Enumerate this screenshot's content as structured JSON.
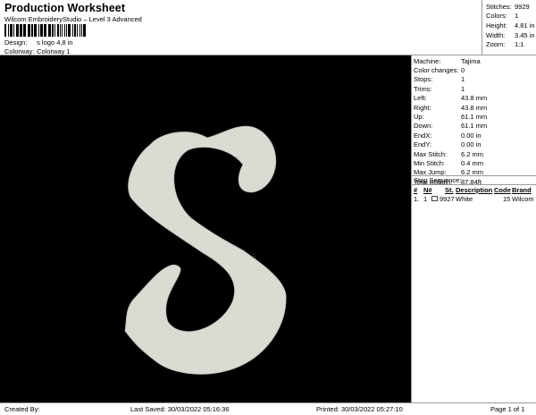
{
  "header": {
    "title": "Production Worksheet",
    "subtitle": "Wilcom EmbroideryStudio – Level 3 Advanced",
    "barcode_text": "s logo 4,8 in",
    "design_label": "Design:",
    "design_value": "s logo 4,8 in",
    "colorway_label": "Colorway:",
    "colorway_value": "Colorway 1"
  },
  "summary": [
    {
      "label": "Stitches:",
      "value": "9929"
    },
    {
      "label": "Colors:",
      "value": "1"
    },
    {
      "label": "Height:",
      "value": "4.81 in"
    },
    {
      "label": "Width:",
      "value": "3.45 in"
    },
    {
      "label": "Zoom:",
      "value": "1:1"
    }
  ],
  "properties": [
    {
      "label": "Machine:",
      "value": "Tajima"
    },
    {
      "label": "Color changes:",
      "value": "0"
    },
    {
      "label": "Stops:",
      "value": "1"
    },
    {
      "label": "Trims:",
      "value": "1"
    },
    {
      "label": "Left:",
      "value": "43.8 mm"
    },
    {
      "label": "Right:",
      "value": "43.8 mm"
    },
    {
      "label": "Up:",
      "value": "61.1 mm"
    },
    {
      "label": "Down:",
      "value": "61.1 mm"
    },
    {
      "label": "EndX:",
      "value": "0.00 in"
    },
    {
      "label": "EndY:",
      "value": "0.00 in"
    },
    {
      "label": "Max Stitch:",
      "value": "6.2 mm"
    },
    {
      "label": "Min Stitch:",
      "value": "0.4 mm"
    },
    {
      "label": "Max Jump:",
      "value": "6.2 mm"
    },
    {
      "label": "Total Bobbin:",
      "value": "87.84ft"
    }
  ],
  "stop_sequence": {
    "title": "Stop Sequence:",
    "columns": [
      "#",
      "N#",
      "St.",
      "Description",
      "Code",
      "Brand"
    ],
    "rows": [
      {
        "num": "1.",
        "n": "1",
        "st": "9927",
        "description": "White",
        "code": "15",
        "brand": "Wilcom",
        "swatch_color": "#ffffff"
      }
    ]
  },
  "design": {
    "background_color": "#000000",
    "thread_color": "#dcdfd6"
  },
  "footer": {
    "created_by": "Created By:",
    "last_saved": "Last Saved: 30/03/2022 05:16:36",
    "printed": "Printed: 30/03/2022 05:27:10",
    "page": "Page 1 of 1"
  }
}
